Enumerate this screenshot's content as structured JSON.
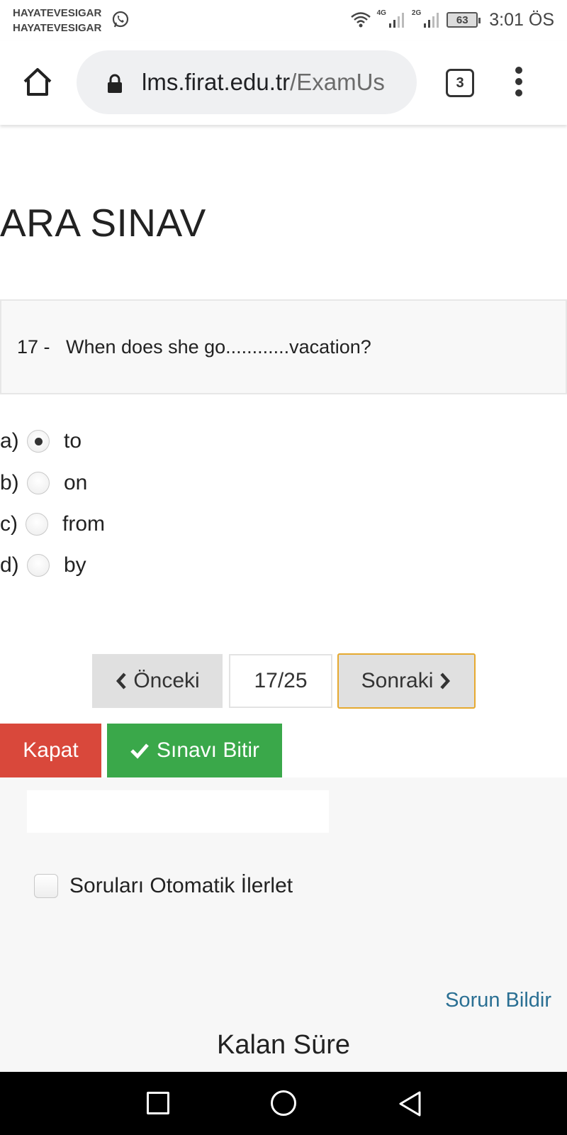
{
  "status_bar": {
    "notification_line1": "HAYATEVESIGAR",
    "notification_line2": "HAYATEVESIGAR",
    "network1": "4G",
    "network2": "2G",
    "battery": "63",
    "time": "3:01 ÖS"
  },
  "browser": {
    "url_domain": "lms.firat.edu.tr",
    "url_path": "/ExamUs",
    "tab_count": "3"
  },
  "exam": {
    "title": "ARA SINAV",
    "question_number": "17 -",
    "question_text": "When does she go............vacation?",
    "options": [
      {
        "letter": "a)",
        "text": "to",
        "selected": true
      },
      {
        "letter": "b)",
        "text": "on",
        "selected": false
      },
      {
        "letter": "c)",
        "text": "from",
        "selected": false
      },
      {
        "letter": "d)",
        "text": "by",
        "selected": false
      }
    ]
  },
  "pagination": {
    "prev_label": "Önceki",
    "current": "17/25",
    "next_label": "Sonraki"
  },
  "actions": {
    "close_label": "Kapat",
    "finish_label": "Sınavı Bitir"
  },
  "footer": {
    "auto_advance_label": "Soruları Otomatik İlerlet",
    "report_label": "Sorun Bildir",
    "remaining_time_label": "Kalan Süre"
  },
  "colors": {
    "close_button": "#d9483b",
    "finish_button": "#3aa84a",
    "next_border": "#e6a92f",
    "link": "#2a6f93"
  }
}
